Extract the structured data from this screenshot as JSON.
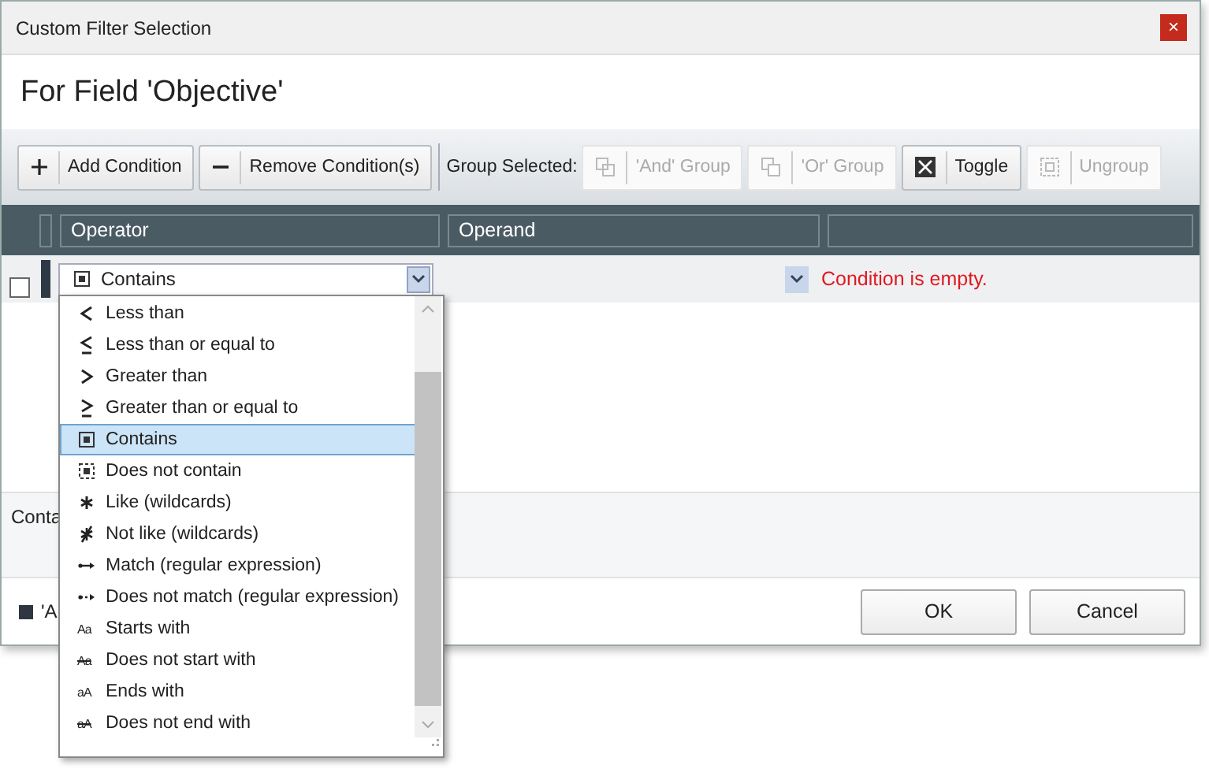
{
  "window": {
    "title": "Custom Filter Selection",
    "close": "×"
  },
  "header": "For Field 'Objective'",
  "toolbar": {
    "buttons": [
      {
        "label": "Add Condition",
        "disabled": false
      },
      {
        "label": "Remove Condition(s)",
        "disabled": false
      }
    ],
    "group_label": "Group Selected:",
    "group_buttons": [
      {
        "label": "'And' Group",
        "disabled": true
      },
      {
        "label": "'Or' Group",
        "disabled": true
      },
      {
        "label": "Toggle",
        "disabled": false
      },
      {
        "label": "Ungroup",
        "disabled": true
      }
    ]
  },
  "table": {
    "columns": [
      "Operator",
      "Operand"
    ],
    "rows": [
      {
        "checked": false,
        "operator": "Contains",
        "message": "Condition is empty."
      }
    ]
  },
  "description": "Conta",
  "footer": {
    "legend": "'A",
    "buttons": [
      "OK",
      "Cancel"
    ]
  },
  "dropdown": {
    "items": [
      {
        "label": "Less than",
        "selected": false
      },
      {
        "label": "Less than or equal to",
        "selected": false
      },
      {
        "label": "Greater than",
        "selected": false
      },
      {
        "label": "Greater than or equal to",
        "selected": false
      },
      {
        "label": "Contains",
        "selected": true
      },
      {
        "label": "Does not contain",
        "selected": false
      },
      {
        "label": "Like (wildcards)",
        "selected": false
      },
      {
        "label": "Not like (wildcards)",
        "selected": false
      },
      {
        "label": "Match (regular expression)",
        "selected": false
      },
      {
        "label": "Does not match (regular expression)",
        "selected": false
      },
      {
        "glyph": "Aa",
        "struck": false,
        "label": "Starts with",
        "selected": false
      },
      {
        "glyph": "Aa",
        "struck": true,
        "label": "Does not start with",
        "selected": false
      },
      {
        "glyph": "aA",
        "struck": false,
        "label": "Ends with",
        "selected": false
      },
      {
        "glyph": "aA",
        "struck": true,
        "label": "Does not end with",
        "selected": false
      }
    ]
  }
}
